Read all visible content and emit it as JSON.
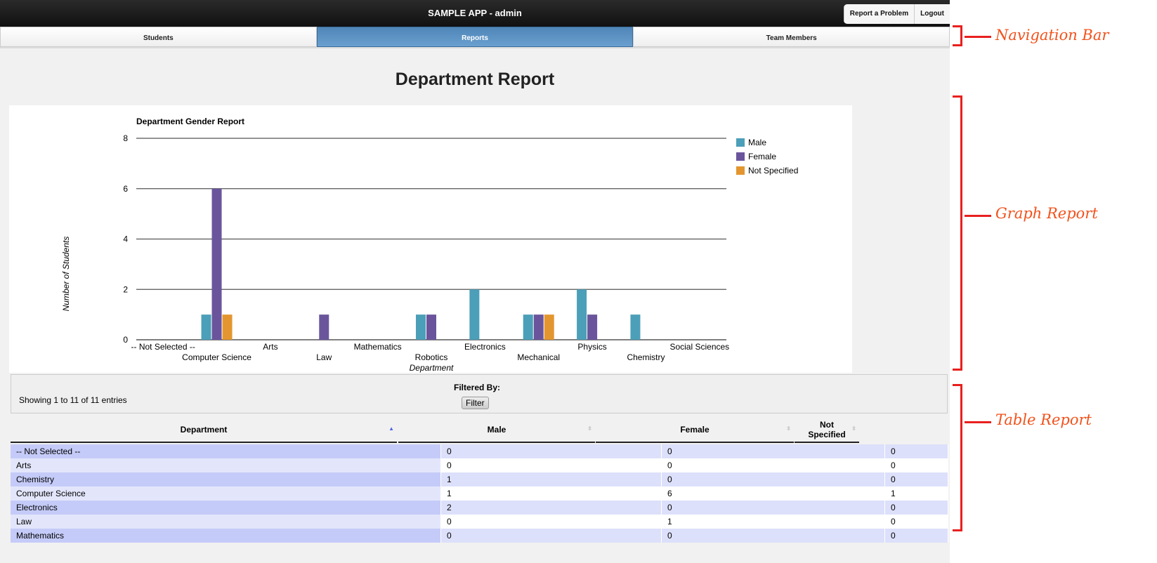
{
  "header": {
    "title": "SAMPLE APP - admin",
    "report_problem": "Report a Problem",
    "logout": "Logout"
  },
  "nav": {
    "tabs": [
      {
        "label": "Students"
      },
      {
        "label": "Reports",
        "active": true
      },
      {
        "label": "Team Members"
      }
    ]
  },
  "page_title": "Department Report",
  "chart_data": {
    "type": "bar",
    "title": "Department Gender Report",
    "xlabel": "Department",
    "ylabel": "Number of Students",
    "ylim": [
      0,
      8
    ],
    "yticks": [
      0,
      2,
      4,
      6,
      8
    ],
    "grid": true,
    "legend": "top-right",
    "categories": [
      "-- Not Selected --",
      "Computer Science",
      "Arts",
      "Law",
      "Mathematics",
      "Robotics",
      "Electronics",
      "Mechanical",
      "Physics",
      "Chemistry",
      "Social Sciences"
    ],
    "series": [
      {
        "name": "Male",
        "color": "#4c9fb8",
        "values": [
          0,
          1,
          0,
          0,
          0,
          1,
          2,
          1,
          2,
          1,
          0
        ]
      },
      {
        "name": "Female",
        "color": "#6a559c",
        "values": [
          0,
          6,
          0,
          1,
          0,
          1,
          0,
          1,
          1,
          0,
          0
        ]
      },
      {
        "name": "Not Specified",
        "color": "#e3962f",
        "values": [
          0,
          1,
          0,
          0,
          0,
          0,
          0,
          1,
          0,
          0,
          0
        ]
      }
    ]
  },
  "table": {
    "showing": "Showing 1 to 11 of 11 entries",
    "filtered_by": "Filtered By:",
    "filter_button": "Filter",
    "columns": [
      "Department",
      "Male",
      "Female",
      "Not Specified"
    ],
    "rows": [
      [
        "-- Not Selected --",
        "0",
        "0",
        "0"
      ],
      [
        "Arts",
        "0",
        "0",
        "0"
      ],
      [
        "Chemistry",
        "1",
        "0",
        "0"
      ],
      [
        "Computer Science",
        "1",
        "6",
        "1"
      ],
      [
        "Electronics",
        "2",
        "0",
        "0"
      ],
      [
        "Law",
        "0",
        "1",
        "0"
      ],
      [
        "Mathematics",
        "0",
        "0",
        "0"
      ]
    ]
  },
  "annotations": {
    "nav": "Navigation Bar",
    "graph": "Graph Report",
    "table": "Table Report"
  }
}
